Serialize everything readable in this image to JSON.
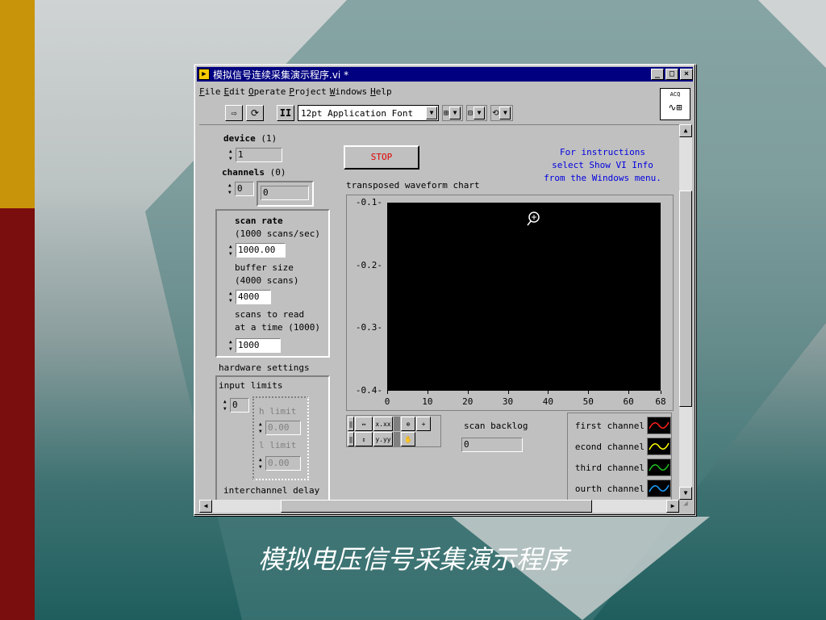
{
  "slide": {
    "caption": "模拟电压信号采集演示程序",
    "colors": {
      "gold_stripe": "#c8940a",
      "red_stripe": "#7a0e0e"
    }
  },
  "window": {
    "title": "模拟信号连续采集演示程序.vi *",
    "buttons": [
      "_",
      "□",
      "×"
    ],
    "menu": [
      "File",
      "Edit",
      "Operate",
      "Project",
      "Windows",
      "Help"
    ],
    "icon_label": "ACQ"
  },
  "toolbar": {
    "run_icon": "run-arrow-icon",
    "continuous_icon": "continuous-run-icon",
    "pause_label": "II",
    "font_select": "12pt Application Font"
  },
  "controls": {
    "device_label": "device",
    "device_index": "(1)",
    "device_value": "1",
    "channels_label": "channels",
    "channels_index": "(0)",
    "channels_spin": "0",
    "channels_value": "0",
    "scan_rate_label": "scan rate",
    "scan_rate_hint": "(1000 scans/sec)",
    "scan_rate_value": "1000.00",
    "buffer_label": "buffer size",
    "buffer_hint": "(4000 scans)",
    "buffer_value": "4000",
    "scans_read_label1": "scans to read",
    "scans_read_label2": "at a time",
    "scans_read_hint": "(1000)",
    "scans_read_value": "1000",
    "hardware_label": "hardware settings",
    "input_limits_label": "input limits",
    "input_limits_index": "0",
    "high_limit_label": "h limit",
    "high_limit_value": "0.00",
    "low_limit_label": "l limit",
    "low_limit_value": "0.00",
    "interchannel_label": "interchannel delay"
  },
  "stop_label": "STOP",
  "instructions": [
    "For instructions",
    "select Show VI Info",
    "from the Windows menu."
  ],
  "chart": {
    "title": "transposed waveform chart",
    "scan_backlog_label": "scan backlog",
    "scan_backlog_value": "0"
  },
  "chart_data": {
    "type": "line",
    "title": "transposed waveform chart",
    "xlabel": "",
    "ylabel": "",
    "xlim": [
      0,
      68
    ],
    "ylim": [
      -0.4,
      -0.1
    ],
    "x_ticks": [
      "0",
      "10",
      "20",
      "30",
      "40",
      "50",
      "60",
      "68"
    ],
    "y_ticks": [
      "-0.1",
      "-0.2",
      "-0.3",
      "-0.4"
    ],
    "series": [
      {
        "name": "first channel",
        "color": "#ff2020",
        "values": []
      },
      {
        "name": "econd channel",
        "color": "#ffff00",
        "values": []
      },
      {
        "name": "third channel",
        "color": "#20c020",
        "values": []
      },
      {
        "name": "ourth channel",
        "color": "#20a0ff",
        "values": []
      }
    ],
    "background": "#000000",
    "grid": false
  }
}
